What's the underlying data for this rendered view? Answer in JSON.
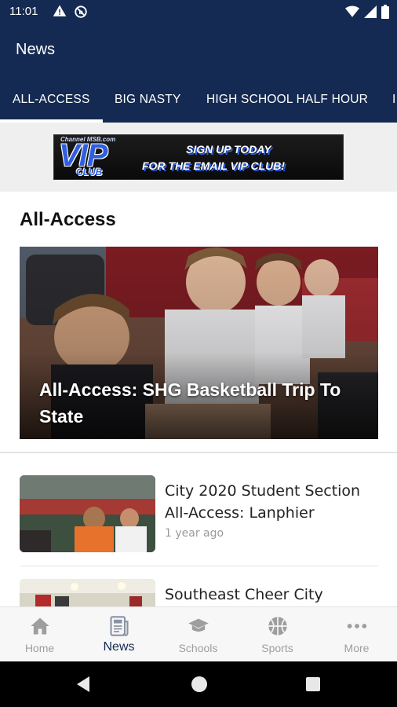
{
  "status_bar": {
    "time": "11:01"
  },
  "app_bar": {
    "title": "News"
  },
  "tabs": [
    {
      "label": "ALL-ACCESS",
      "selected": true
    },
    {
      "label": "BIG NASTY",
      "selected": false
    },
    {
      "label": "HIGH SCHOOL HALF HOUR",
      "selected": false
    },
    {
      "label": "I",
      "selected": false
    }
  ],
  "banner": {
    "site": "Channel MSB.com",
    "vip": "VIP",
    "club": "CLUB",
    "line1": "SIGN UP TODAY",
    "line2": "FOR THE EMAIL VIP CLUB!"
  },
  "section": {
    "title": "All-Access"
  },
  "hero": {
    "title": "All-Access: SHG Basketball Trip To State"
  },
  "articles": [
    {
      "title": "City 2020 Student Section All-Access: Lanphier",
      "meta": "1 year ago"
    },
    {
      "title": "Southeast Cheer City Practice",
      "meta": ""
    }
  ],
  "bottom_nav": [
    {
      "label": "Home",
      "icon": "home-icon",
      "active": false
    },
    {
      "label": "News",
      "icon": "news-icon",
      "active": true
    },
    {
      "label": "Schools",
      "icon": "graduation-cap-icon",
      "active": false
    },
    {
      "label": "Sports",
      "icon": "basketball-icon",
      "active": false
    },
    {
      "label": "More",
      "icon": "more-icon",
      "active": false
    }
  ],
  "colors": {
    "primary": "#152a52",
    "nav_inactive": "#9e9e9e",
    "banner_blue": "#2f5fe0"
  }
}
